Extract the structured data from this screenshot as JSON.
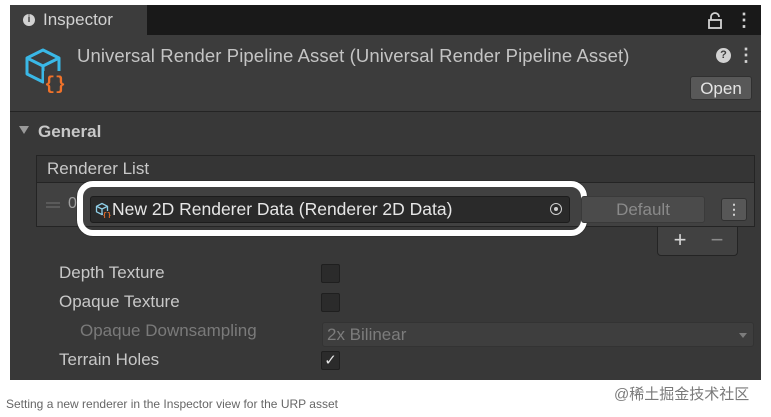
{
  "window": {
    "tab_label": "Inspector",
    "tab_icon": "info-icon",
    "lock_icon": "lock-icon",
    "menu_icon": "kebab-menu-icon"
  },
  "header": {
    "asset_icon": "urp-asset-icon",
    "title": "Universal Render Pipeline Asset (Universal Render Pipeline Asset)",
    "help_icon": "help-icon",
    "open_label": "Open"
  },
  "general": {
    "section_label": "General",
    "renderer_list": {
      "header_label": "Renderer List",
      "items": [
        {
          "index": "0",
          "value": "New 2D Renderer Data (Renderer 2D Data)",
          "default_label": "Default"
        }
      ],
      "add_label": "+",
      "remove_label": "−"
    },
    "properties": [
      {
        "label": "Depth Texture",
        "checked": false
      },
      {
        "label": "Opaque Texture",
        "checked": false
      },
      {
        "label": "Opaque Downsampling",
        "value": "2x Bilinear",
        "disabled": true
      },
      {
        "label": "Terrain Holes",
        "checked": true,
        "check_glyph": "✓"
      }
    ]
  },
  "caption": "Setting a new renderer in the Inspector view for the URP asset",
  "watermark": "@稀土掘金技术社区",
  "colors": {
    "panel_bg": "#383838",
    "tabbar_bg": "#191919",
    "field_bg": "#2a2a2a",
    "highlight_ring": "#ffffff",
    "icon_blue": "#3ab8e6",
    "icon_orange": "#f0722a"
  }
}
